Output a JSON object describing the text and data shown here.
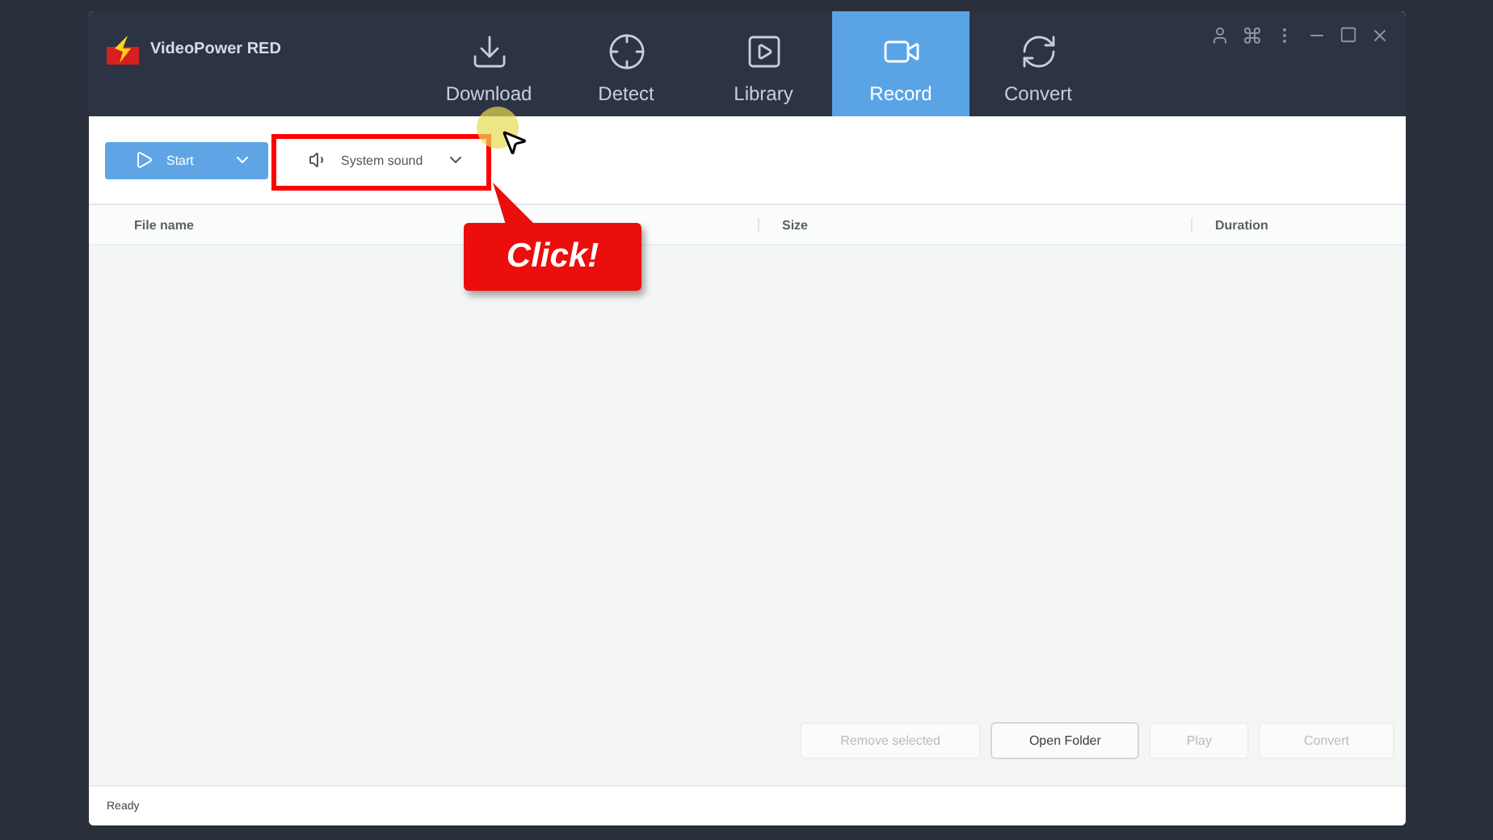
{
  "app": {
    "name": "VideoPower RED"
  },
  "tabs": [
    {
      "label": "Download",
      "selected": false
    },
    {
      "label": "Detect",
      "selected": false
    },
    {
      "label": "Library",
      "selected": false
    },
    {
      "label": "Record",
      "selected": true
    },
    {
      "label": "Convert",
      "selected": false
    }
  ],
  "toolbar": {
    "start": {
      "label": "Start"
    },
    "audio": {
      "label": "System sound"
    }
  },
  "annotation": {
    "label": "Click!"
  },
  "table": {
    "columns": [
      "File name",
      "Size",
      "Duration"
    ]
  },
  "actions": [
    {
      "label": "Remove selected",
      "disabled": true
    },
    {
      "label": "Open Folder",
      "disabled": false
    },
    {
      "label": "Play",
      "disabled": true
    },
    {
      "label": "Convert",
      "disabled": true
    }
  ],
  "status_bar": {
    "text": "Ready"
  }
}
